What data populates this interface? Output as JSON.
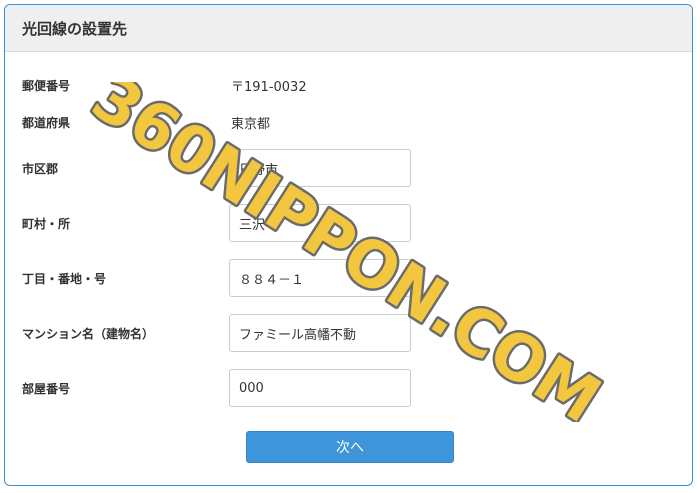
{
  "form": {
    "title": "光回線の設置先",
    "postal_label": "郵便番号",
    "postal_value": "〒191-0032",
    "prefecture_label": "都道府県",
    "prefecture_value": "東京都",
    "city_label": "市区郡",
    "city_value": "日野市",
    "town_label": "町村・所",
    "town_value": "三沢",
    "block_label": "丁目・番地・号",
    "block_value": "８８４－１",
    "building_label": "マンション名（建物名）",
    "building_value": "ファミール高幡不動",
    "room_label": "部屋番号",
    "room_value": "000",
    "next_label": "次へ"
  },
  "watermark": {
    "text": "360NIPPON.COM",
    "fill_color": "#f3c640",
    "stroke_color": "#6b6b6b"
  },
  "colors": {
    "accent": "#3f95d9",
    "panel_border": "#3a8fd6",
    "header_bg": "#efefef"
  }
}
